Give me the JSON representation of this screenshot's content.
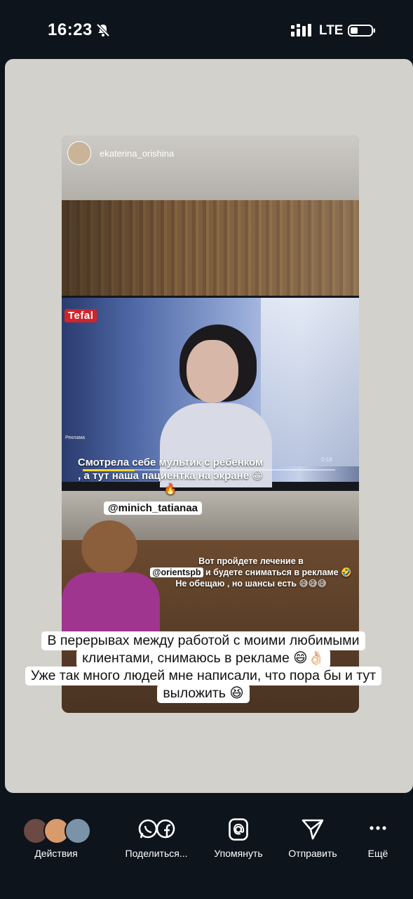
{
  "status_bar": {
    "time": "16:23",
    "network": "LTE"
  },
  "story": {
    "author": "ekaterina_orishina",
    "tv_brand": "Tefal",
    "tv_label": "Реклама",
    "tv_time": "0:18",
    "sticker_main": "Смотрела себе мультик с ребенком , а тут наша пациентка на экране 😁🔥",
    "mention_1": "@minich_tatianaa",
    "sticker_2_line1": "Вот пройдете лечение в",
    "mention_2": "@orientspb",
    "sticker_2_line2": "и будете сниматься в рекламе 🤣",
    "sticker_2_line3": "Не обещаю , но шансы есть 😅😅😅"
  },
  "caption": {
    "line1": "В перерывах между работой с моими любимыми",
    "line2": "клиентами, снимаюсь в рекламе 😄👌🏻",
    "line3": "Уже так много людей мне написали, что пора бы и тут",
    "line4": "выложить 😆"
  },
  "actions": [
    {
      "label": "Действия",
      "icon": "avatars-stack"
    },
    {
      "label": "Поделиться...",
      "icon": "whatsapp-facebook-icon"
    },
    {
      "label": "Упомянуть",
      "icon": "mention-icon"
    },
    {
      "label": "Отправить",
      "icon": "send-icon"
    },
    {
      "label": "Ещё",
      "icon": "more-icon"
    }
  ]
}
